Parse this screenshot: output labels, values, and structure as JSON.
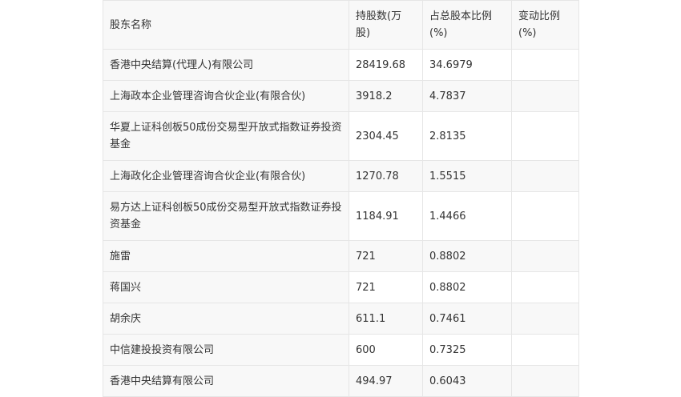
{
  "table": {
    "headers": [
      "股东名称",
      "持股数(万股)",
      "占总股本比例(%)",
      "变动比例(%)"
    ],
    "rows": [
      [
        "香港中央结算(代理人)有限公司",
        "28419.68",
        "34.6979",
        ""
      ],
      [
        "上海政本企业管理咨询合伙企业(有限合伙)",
        "3918.2",
        "4.7837",
        ""
      ],
      [
        "华夏上证科创板50成份交易型开放式指数证券投资基金",
        "2304.45",
        "2.8135",
        ""
      ],
      [
        "上海政化企业管理咨询合伙企业(有限合伙)",
        "1270.78",
        "1.5515",
        ""
      ],
      [
        "易方达上证科创板50成份交易型开放式指数证券投资基金",
        "1184.91",
        "1.4466",
        ""
      ],
      [
        "施雷",
        "721",
        "0.8802",
        ""
      ],
      [
        "蒋国兴",
        "721",
        "0.8802",
        ""
      ],
      [
        "胡余庆",
        "611.1",
        "0.7461",
        ""
      ],
      [
        "中信建投投资有限公司",
        "600",
        "0.7325",
        ""
      ],
      [
        "香港中央结算有限公司",
        "494.97",
        "0.6043",
        ""
      ]
    ]
  }
}
